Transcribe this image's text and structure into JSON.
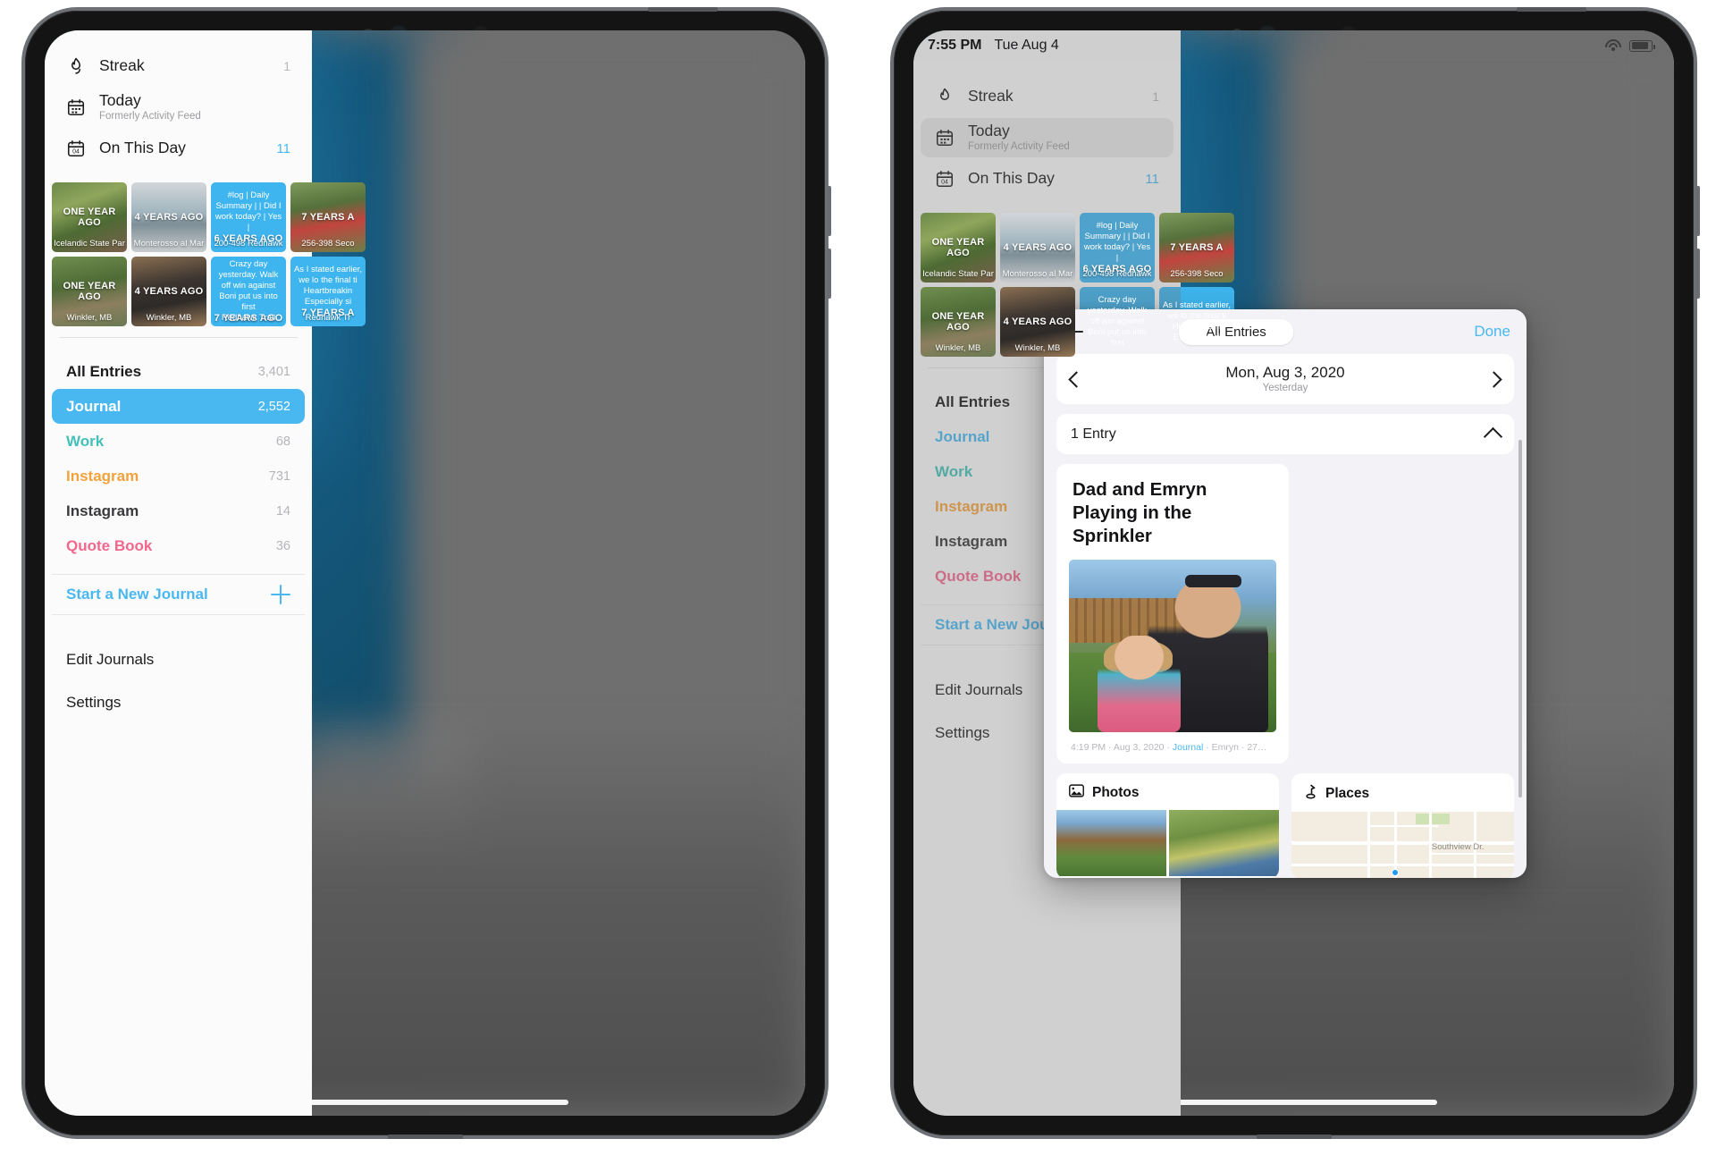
{
  "left_device": {
    "sidebar": {
      "nav": [
        {
          "label": "Streak",
          "sub": "",
          "count": "1",
          "icon": "flame-icon"
        },
        {
          "label": "Today",
          "sub": "Formerly Activity Feed",
          "count": "",
          "icon": "calendar-today-icon"
        },
        {
          "label": "On This Day",
          "sub": "",
          "count": "11",
          "icon": "calendar-04-icon"
        }
      ],
      "memories": [
        {
          "years": "ONE YEAR AGO",
          "location": "Icelandic State Par",
          "text": "",
          "style": "photo1"
        },
        {
          "years": "4 YEARS AGO",
          "location": "Monterosso al Mar",
          "text": "",
          "style": "photo2"
        },
        {
          "years": "6 YEARS AGO",
          "location": "200-498 Redhawk",
          "text": "#log | Daily Summary | | Did I work today? | Yes |",
          "style": "blue"
        },
        {
          "years": "7 YEARS A",
          "location": "256-398 Seco",
          "text": "",
          "style": "photo6"
        },
        {
          "years": "ONE YEAR AGO",
          "location": "Winkler, MB",
          "text": "",
          "style": "photo3"
        },
        {
          "years": "4 YEARS AGO",
          "location": "Winkler, MB",
          "text": "",
          "style": "photo5"
        },
        {
          "years": "7 YEARS AGO",
          "location": "Redhawk Trail",
          "text": "Crazy day yesterday. Walk off win against Boni put us into first",
          "style": "blue"
        },
        {
          "years": "7 YEARS A",
          "location": "Redhawk Tr",
          "text": "As I stated earlier, we lo the final ti Heartbreakin Especially si",
          "style": "blue"
        }
      ],
      "journals": [
        {
          "name": "All Entries",
          "count": "3,401",
          "color": "#1c1c1e",
          "selected": false
        },
        {
          "name": "Journal",
          "count": "2,552",
          "color": "#ffffff",
          "selected": true
        },
        {
          "name": "Work",
          "count": "68",
          "color": "#44c0b8",
          "selected": false
        },
        {
          "name": "Instagram",
          "count": "731",
          "color": "#f2a23c",
          "selected": false
        },
        {
          "name": "Instagram",
          "count": "14",
          "color": "#3a3a3c",
          "selected": false
        },
        {
          "name": "Quote Book",
          "count": "36",
          "color": "#f2678e",
          "selected": false
        }
      ],
      "new_journal_label": "Start a New Journal",
      "bottom_links": [
        {
          "label": "Edit Journals"
        },
        {
          "label": "Settings"
        }
      ]
    }
  },
  "right_device": {
    "status_bar": {
      "time": "7:55 PM",
      "date": "Tue Aug 4",
      "wifi_icon": "wifi-icon",
      "battery_icon": "battery-icon"
    },
    "popover": {
      "add_icon": "plus-icon",
      "segment_label": "All Entries",
      "done_label": "Done",
      "date_header": {
        "date": "Mon, Aug 3, 2020",
        "relative": "Yesterday",
        "prev_icon": "chevron-left-icon",
        "next_icon": "chevron-right-icon"
      },
      "entry_count_label": "1 Entry",
      "collapse_icon": "chevron-up-icon",
      "entry": {
        "title": "Dad and Emryn Playing in the Sprinkler",
        "meta_time": "4:19 PM",
        "meta_date": "Aug 3, 2020",
        "meta_journal": "Journal",
        "meta_tag": "Emryn",
        "meta_more": "27…",
        "meta_sep": " · "
      },
      "photos_card": {
        "title": "Photos",
        "icon": "photo-icon"
      },
      "places_card": {
        "title": "Places",
        "icon": "pin-icon",
        "street_label": "Southview Dr."
      }
    }
  },
  "colors": {
    "accent_blue": "#4ab8f0",
    "selected_row": "#4ab8f0",
    "work_teal": "#44c0b8",
    "instagram_orange": "#f2a23c",
    "quote_pink": "#f2678e",
    "count_grey": "#b5b5ba"
  }
}
